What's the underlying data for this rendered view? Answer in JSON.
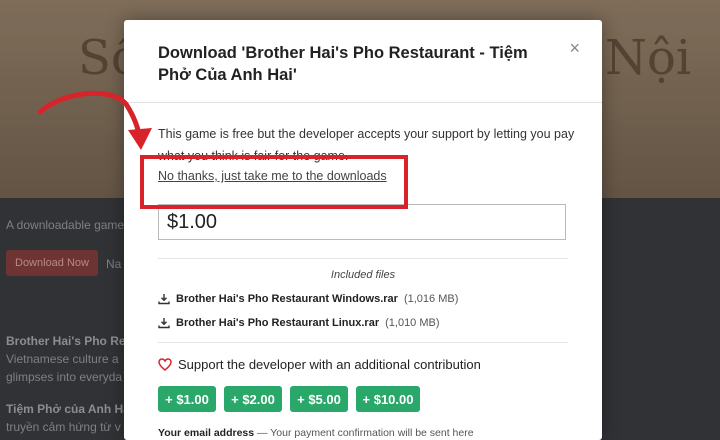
{
  "background": {
    "title_left": "Sổ",
    "title_right": "Nội",
    "tagline": "A downloadable game",
    "download_button": "Download Now",
    "name_fragment": "Na",
    "desc_title": "Brother Hai's Pho Re",
    "desc_line1": "Vietnamese culture a",
    "desc_line2": "glimpses into everyda",
    "desc_title2": "Tiệm Phở của Anh Ha",
    "desc_line3": "truyền cảm hứng từ v"
  },
  "modal": {
    "title": "Download 'Brother Hai's Pho Restaurant - Tiệm Phở Của Anh Hai'",
    "close_label": "×",
    "intro": "This game is free but the developer accepts your support by letting you pay what you think is fair for the game.",
    "no_thanks": "No thanks, just take me to the downloads",
    "price_value": "$1.00",
    "files_heading": "Included files",
    "files": [
      {
        "name": "Brother Hai's Pho Restaurant Windows.rar",
        "size": "(1,016 MB)"
      },
      {
        "name": "Brother Hai's Pho Restaurant Linux.rar",
        "size": "(1,010 MB)"
      }
    ],
    "support_text": "Support the developer with an additional contribution",
    "tip_buttons": [
      "+ $1.00",
      "+ $2.00",
      "+ $5.00",
      "+ $10.00"
    ],
    "email_label": "Your email address",
    "email_hint": "— Your payment confirmation will be sent here"
  },
  "colors": {
    "accent_green": "#2aa869",
    "highlight_red": "#d8232a"
  }
}
